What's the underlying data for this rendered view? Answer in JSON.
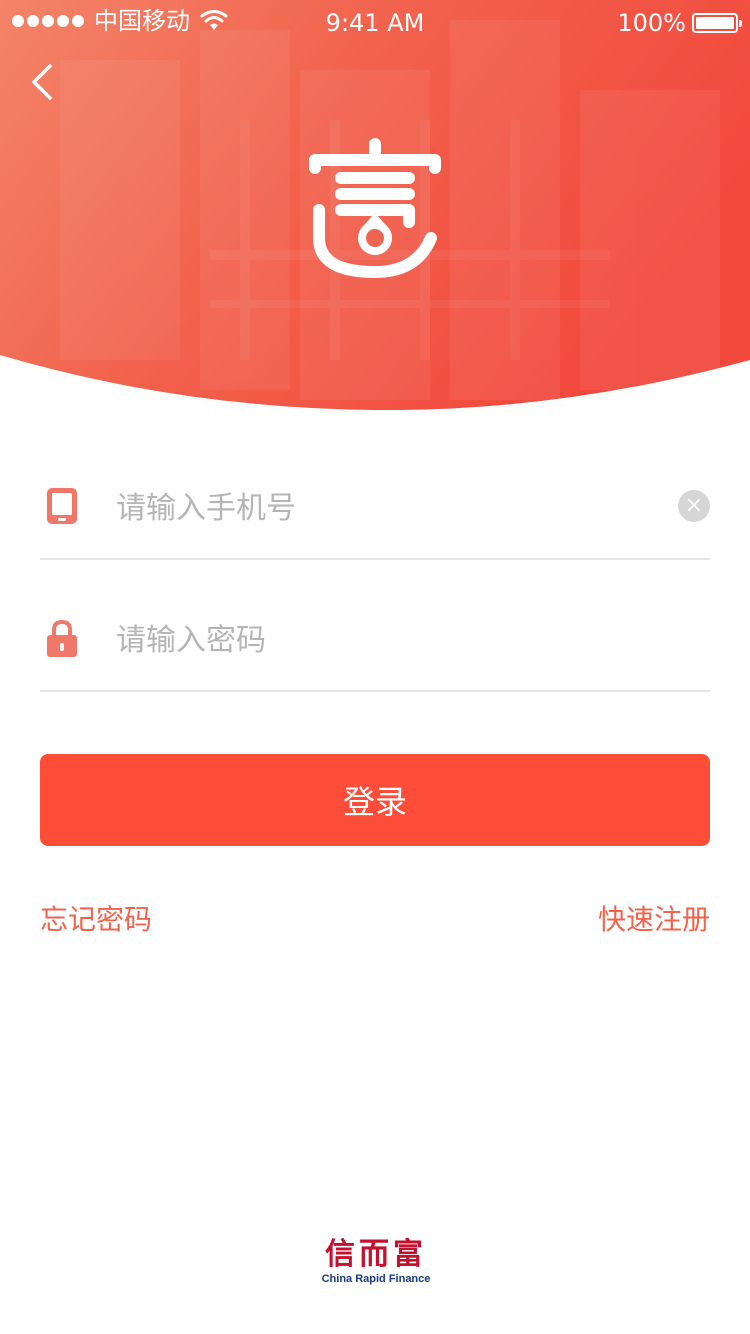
{
  "status_bar": {
    "carrier": "中国移动",
    "time": "9:41 AM",
    "battery": "100%"
  },
  "header": {
    "back_icon": "chevron-left-icon",
    "logo_icon": "brand-logo-icon",
    "colors": {
      "gradient_start": "#f27a5e",
      "gradient_end": "#f24a3c"
    }
  },
  "form": {
    "phone": {
      "icon": "phone-icon",
      "placeholder": "请输入手机号",
      "value": "",
      "clear_icon": "clear-icon"
    },
    "password": {
      "icon": "lock-icon",
      "placeholder": "请输入密码",
      "value": ""
    },
    "login_label": "登录",
    "forgot_label": "忘记密码",
    "register_label": "快速注册",
    "colors": {
      "accent": "#fe4d38",
      "link": "#f2634c",
      "icon": "#f0786a"
    }
  },
  "footer": {
    "brand_cn": "信而富",
    "brand_en": "China Rapid Finance"
  }
}
